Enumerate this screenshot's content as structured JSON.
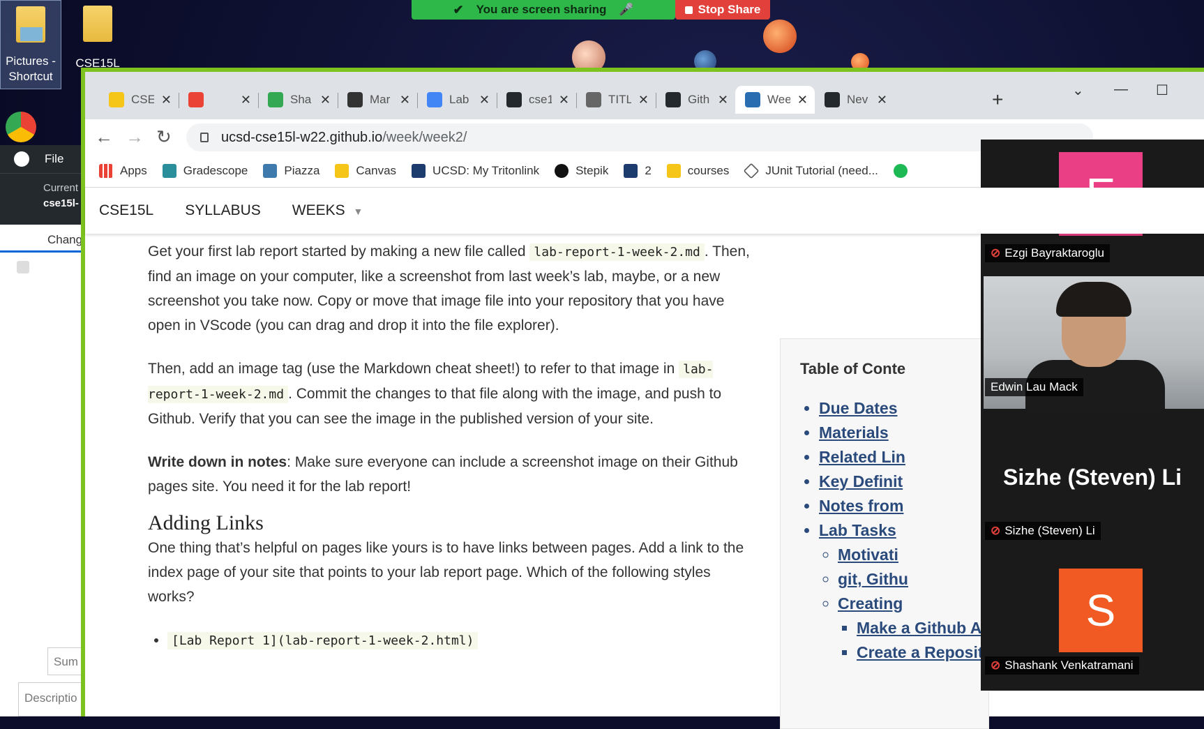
{
  "zoom": {
    "sharing_label": "You are screen sharing",
    "stop_label": "Stop Share"
  },
  "desktop": {
    "icons": [
      "Pictures - Shortcut",
      "CSE15L"
    ]
  },
  "github_desktop": {
    "menu_file": "File",
    "current_label": "Current",
    "repo_name": "cse15l-",
    "tab_changes": "Chang",
    "summary_placeholder": "Sum",
    "description_placeholder": "Descriptio"
  },
  "browser": {
    "tabs": [
      {
        "title": "CSE",
        "icon_color": "#f5c518"
      },
      {
        "title": "",
        "icon_color": "#ea4335"
      },
      {
        "title": "Sha",
        "icon_color": "#34a853"
      },
      {
        "title": "Mar",
        "icon_color": "#333333"
      },
      {
        "title": "Lab",
        "icon_color": "#4285f4"
      },
      {
        "title": "cse1",
        "icon_color": "#24292e"
      },
      {
        "title": "TITL",
        "icon_color": "#666666"
      },
      {
        "title": "Gith",
        "icon_color": "#24292e"
      },
      {
        "title": "Wee",
        "icon_color": "#2a6db0"
      },
      {
        "title": "Nev",
        "icon_color": "#24292e"
      }
    ],
    "url_host": "ucsd-cse15l-w22.github.io",
    "url_path": "/week/week2/",
    "bookmarks": [
      "Apps",
      "Gradescope",
      "Piazza",
      "Canvas",
      "UCSD: My Tritonlink",
      "Stepik",
      "2",
      "courses",
      "JUnit Tutorial (need..."
    ]
  },
  "site": {
    "nav": {
      "brand": "CSE15L",
      "syllabus": "SYLLABUS",
      "weeks": "WEEKS"
    },
    "p1_before": "Get your first lab report started by making a new file called ",
    "p1_code": "lab-report-1-week-2.md",
    "p1_after": ". Then, find an image on your computer, like a screenshot from last week’s lab, maybe, or a new screenshot you take now. Copy or move that image file into your repository that you have open in VScode (you can drag and drop it into the file explorer).",
    "p2_before": "Then, add an image tag (use the Markdown cheat sheet!) to refer to that image in ",
    "p2_code": "lab-report-1-week-2.md",
    "p2_after": ". Commit the changes to that file along with the image, and push to Github. Verify that you can see the image in the published version of your site.",
    "p3_bold": "Write down in notes",
    "p3_after": ": Make sure everyone can include a screenshot image on their Github pages site. You need it for the lab report!",
    "h2": "Adding Links",
    "p4": "One thing that’s helpful on pages like yours is to have links between pages. Add a link to the index page of your site that points to your lab report page. Which of the following styles works?",
    "li1_code": "[Lab Report 1](lab-report-1-week-2.html)",
    "toc": {
      "title": "Table of Conte",
      "items": [
        "Due Dates",
        "Materials",
        "Related Lin",
        "Key Definit",
        "Notes from",
        "Lab Tasks"
      ],
      "sub_items": [
        "Motivati",
        "git, Githu",
        "Creating"
      ],
      "sub_sub_items": [
        "Make a Github Account",
        "Create a Repository"
      ]
    }
  },
  "participants": {
    "p1": {
      "initial": "E",
      "name": "Ezgi Bayraktaroglu",
      "color": "#ea3f84"
    },
    "p2": {
      "name": "Edwin Lau Mack"
    },
    "p3": {
      "name": "Sizhe (Steven) Li",
      "display": "Sizhe (Steven) Li"
    },
    "p4": {
      "initial": "S",
      "name": "Shashank Venkatramani",
      "color": "#f15a22"
    }
  }
}
